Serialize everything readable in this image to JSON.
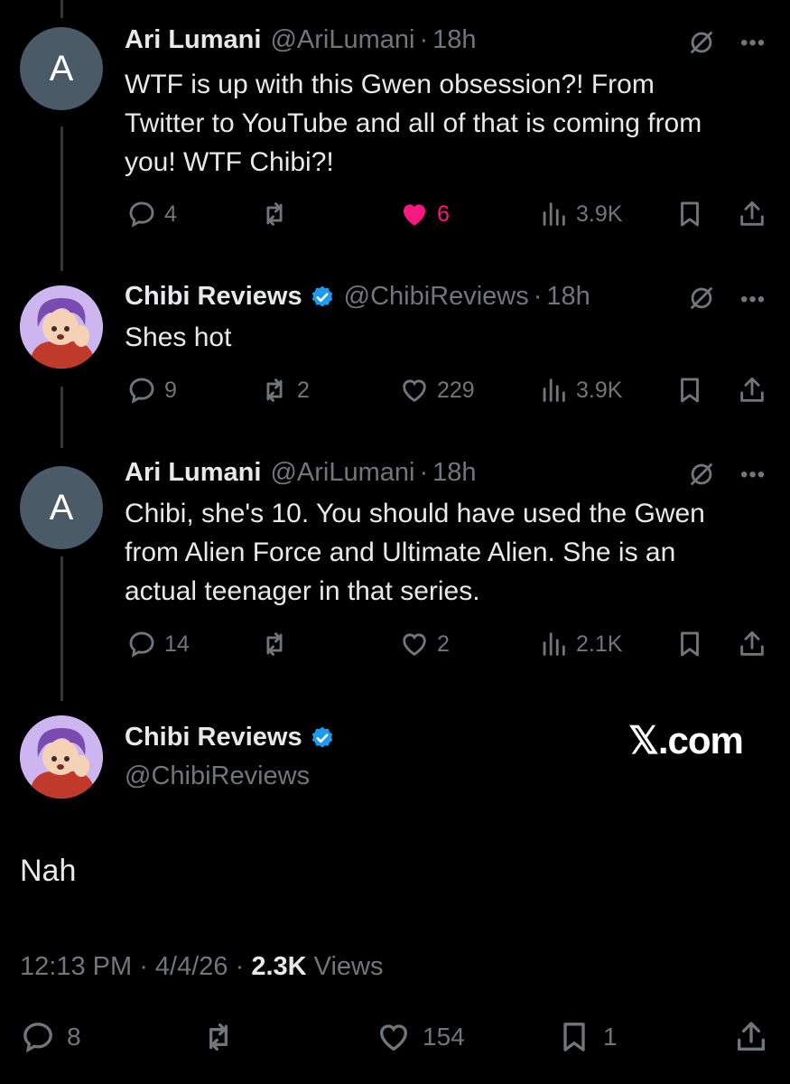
{
  "tweets": [
    {
      "avatar": "A",
      "name": "Ari Lumani",
      "handle": "@AriLumani",
      "time": "18h",
      "text": "WTF is up with this Gwen obsession?! From Twitter to YouTube and all of that is coming from you! WTF Chibi?!",
      "replies": "4",
      "retweets": "",
      "likes": "6",
      "views": "3.9K",
      "liked": true
    },
    {
      "avatar": "chibi-avatar",
      "name": "Chibi Reviews",
      "handle": "@ChibiReviews",
      "time": "18h",
      "verified": true,
      "text": "Shes hot",
      "replies": "9",
      "retweets": "2",
      "likes": "229",
      "views": "3.9K",
      "liked": false
    },
    {
      "avatar": "A",
      "name": "Ari Lumani",
      "handle": "@AriLumani",
      "time": "18h",
      "text": "Chibi, she's 10. You should have used the Gwen from Alien Force and Ultimate Alien. She is an actual teenager in that series.",
      "replies": "14",
      "retweets": "",
      "likes": "2",
      "views": "2.1K",
      "liked": false
    }
  ],
  "focused": {
    "name": "Chibi Reviews",
    "handle": "@ChibiReviews",
    "verified": true,
    "text": "Nah",
    "time": "12:13 PM",
    "date": "4/4/26",
    "views_count": "2.3K",
    "views_label": "Views",
    "replies": "8",
    "retweets": "",
    "likes": "154",
    "bookmarks": "1"
  },
  "watermark": "𝕏.com",
  "colors": {
    "background": "#000000",
    "text": "#e7e9ea",
    "muted": "#71767b",
    "like": "#f91880",
    "verified": "#1d9bf0"
  }
}
